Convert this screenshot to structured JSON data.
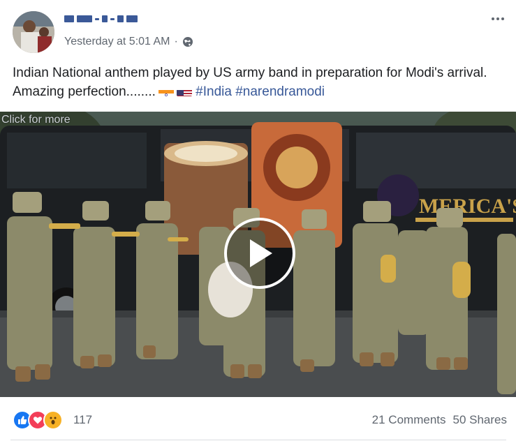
{
  "post": {
    "author_name": "▬▬ ▬ ▬▬",
    "timestamp": "Yesterday at 5:01 AM",
    "privacy_icon": "globe-icon",
    "more_icon": "more-horizontal-icon",
    "caption_text": "Indian National anthem played by US army band in preparation for Modi's arrival. Amazing perfection........",
    "flags": [
      "india-flag",
      "us-flag"
    ],
    "hashtags": [
      "#India",
      "#narendramodi"
    ]
  },
  "video": {
    "overlay_text": "Click for more",
    "play_icon": "play-icon",
    "bus_sign": "MERICA'S"
  },
  "engagement": {
    "reaction_icons": [
      "like-icon",
      "love-icon",
      "wow-icon"
    ],
    "reaction_count": "117",
    "comments": "21 Comments",
    "shares": "50 Shares"
  },
  "colors": {
    "link": "#385898",
    "meta": "#606770",
    "text": "#1c1e21",
    "like": "#1877f2",
    "love": "#f33e58",
    "wow": "#f7b125"
  }
}
